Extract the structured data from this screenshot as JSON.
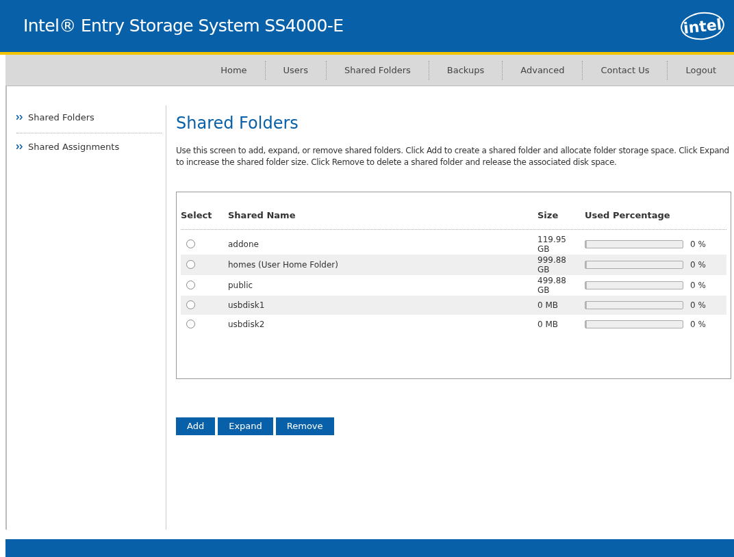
{
  "header": {
    "title": "Intel® Entry Storage System SS4000-E",
    "logo": "intel"
  },
  "nav": [
    {
      "label": "Home"
    },
    {
      "label": "Users"
    },
    {
      "label": "Shared Folders"
    },
    {
      "label": "Backups"
    },
    {
      "label": "Advanced"
    },
    {
      "label": "Contact Us"
    },
    {
      "label": "Logout"
    }
  ],
  "sidebar": {
    "items": [
      {
        "label": "Shared Folders"
      },
      {
        "label": "Shared Assignments"
      }
    ]
  },
  "page": {
    "title": "Shared Folders",
    "description": "Use this screen to add, expand, or remove shared folders. Click Add to create a shared folder and allocate folder storage space. Click Expand to increase the shared folder size. Click Remove to delete a shared folder and release the associated disk space."
  },
  "table": {
    "columns": [
      "Select",
      "Shared Name",
      "Size",
      "Used Percentage"
    ],
    "rows": [
      {
        "selected": false,
        "name": "addone",
        "size": "119.95 GB",
        "level": 0,
        "reading": "0 %"
      },
      {
        "selected": false,
        "name": "homes (User Home Folder)",
        "size": "999.88 GB",
        "level": 0,
        "reading": "0 %"
      },
      {
        "selected": false,
        "name": "public",
        "size": "499.88 GB",
        "level": 0,
        "reading": "0 %"
      },
      {
        "selected": false,
        "name": "usbdisk1",
        "size": "0 MB",
        "level": 0,
        "reading": "0 %"
      },
      {
        "selected": false,
        "name": "usbdisk2",
        "size": "0 MB",
        "level": 0,
        "reading": "0 %"
      }
    ]
  },
  "buttons": [
    "Add",
    "Expand",
    "Remove"
  ]
}
